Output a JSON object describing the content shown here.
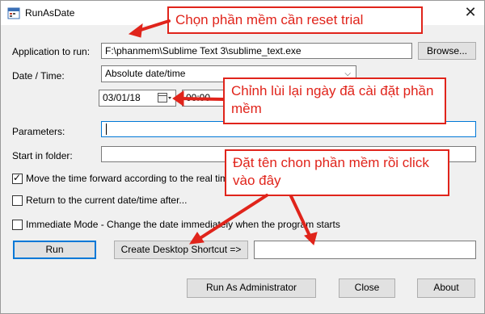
{
  "window": {
    "title": "RunAsDate",
    "close_glyph": "✕"
  },
  "labels": {
    "application": "Application to run:",
    "date_time": "Date / Time:",
    "parameters": "Parameters:",
    "start_in": "Start in folder:"
  },
  "fields": {
    "application_value": "F:\\phanmem\\Sublime Text 3\\sublime_text.exe",
    "date_mode": "Absolute date/time",
    "date_value": "03/01/18",
    "time_value": "00:00",
    "parameters_value": "",
    "start_in_value": "",
    "shortcut_name": ""
  },
  "checkboxes": {
    "move_forward": {
      "label": "Move the time forward according to the real time",
      "checked": true
    },
    "return_current": {
      "label": "Return to the current date/time after...",
      "checked": false
    },
    "immediate": {
      "label": "Immediate Mode - Change the date immediately when the program starts",
      "checked": false
    }
  },
  "buttons": {
    "browse": "Browse...",
    "run": "Run",
    "create_shortcut": "Create Desktop Shortcut =>",
    "run_admin": "Run As Administrator",
    "close": "Close",
    "about": "About"
  },
  "annotations": {
    "callout_1": "Chọn phần mềm cần reset trial",
    "callout_2": "Chỉnh lùi lại ngày đã cài đặt phần mềm",
    "callout_3": "Đặt tên chon phần mềm rồi click vào đây"
  },
  "colors": {
    "annotation": "#e0241b",
    "window_bg": "#f0f0f0"
  },
  "icons": [
    "runasdate-app-icon",
    "calendar-icon",
    "chevron-down-icon",
    "close-icon"
  ]
}
